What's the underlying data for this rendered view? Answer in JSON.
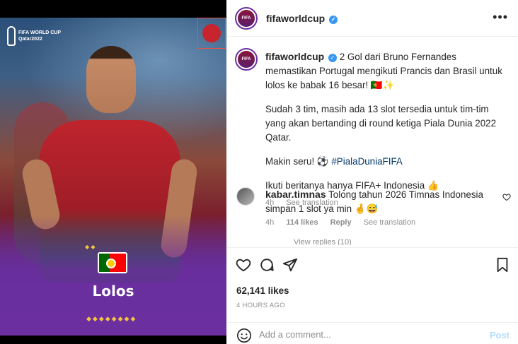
{
  "post_image": {
    "logo_line1": "FIFA WORLD CUP",
    "logo_line2": "Qatar2022",
    "headline": "Lolos",
    "flag_name": "portugal-flag"
  },
  "header": {
    "username": "fifaworldcup",
    "more_label": "•••"
  },
  "caption": {
    "username": "fifaworldcup",
    "line1": "2 Gol dari Bruno Fernandes memastikan Portugal mengikuti Prancis dan Brasil untuk lolos ke babak 16 besar! 🇵🇹✨",
    "line2": "Sudah 3 tim, masih ada 13 slot tersedia untuk tim-tim yang akan bertanding di round ketiga Piala Dunia 2022 Qatar.",
    "line3_prefix": "Makin seru! ⚽",
    "hashtag": "#PialaDuniaFIFA",
    "line4": "Ikuti beritanya hanya FIFA+ Indonesia 👍",
    "time": "4h",
    "see_translation": "See translation"
  },
  "comment": {
    "username": "kabar.timnas",
    "text": "Tolong tahun 2026 Timnas Indonesia simpan 1 slot ya min 🤞😅",
    "time": "4h",
    "likes": "114 likes",
    "reply": "Reply",
    "see_translation": "See translation",
    "view_replies": "View replies (10)"
  },
  "actions": {
    "likes": "62,141 likes",
    "timestamp": "4 HOURS AGO"
  },
  "add_comment": {
    "placeholder": "Add a comment...",
    "post_label": "Post"
  },
  "colors": {
    "accent_blue": "#3897f0",
    "post_disabled": "#b3dbff",
    "purple": "#6b2fa0"
  }
}
